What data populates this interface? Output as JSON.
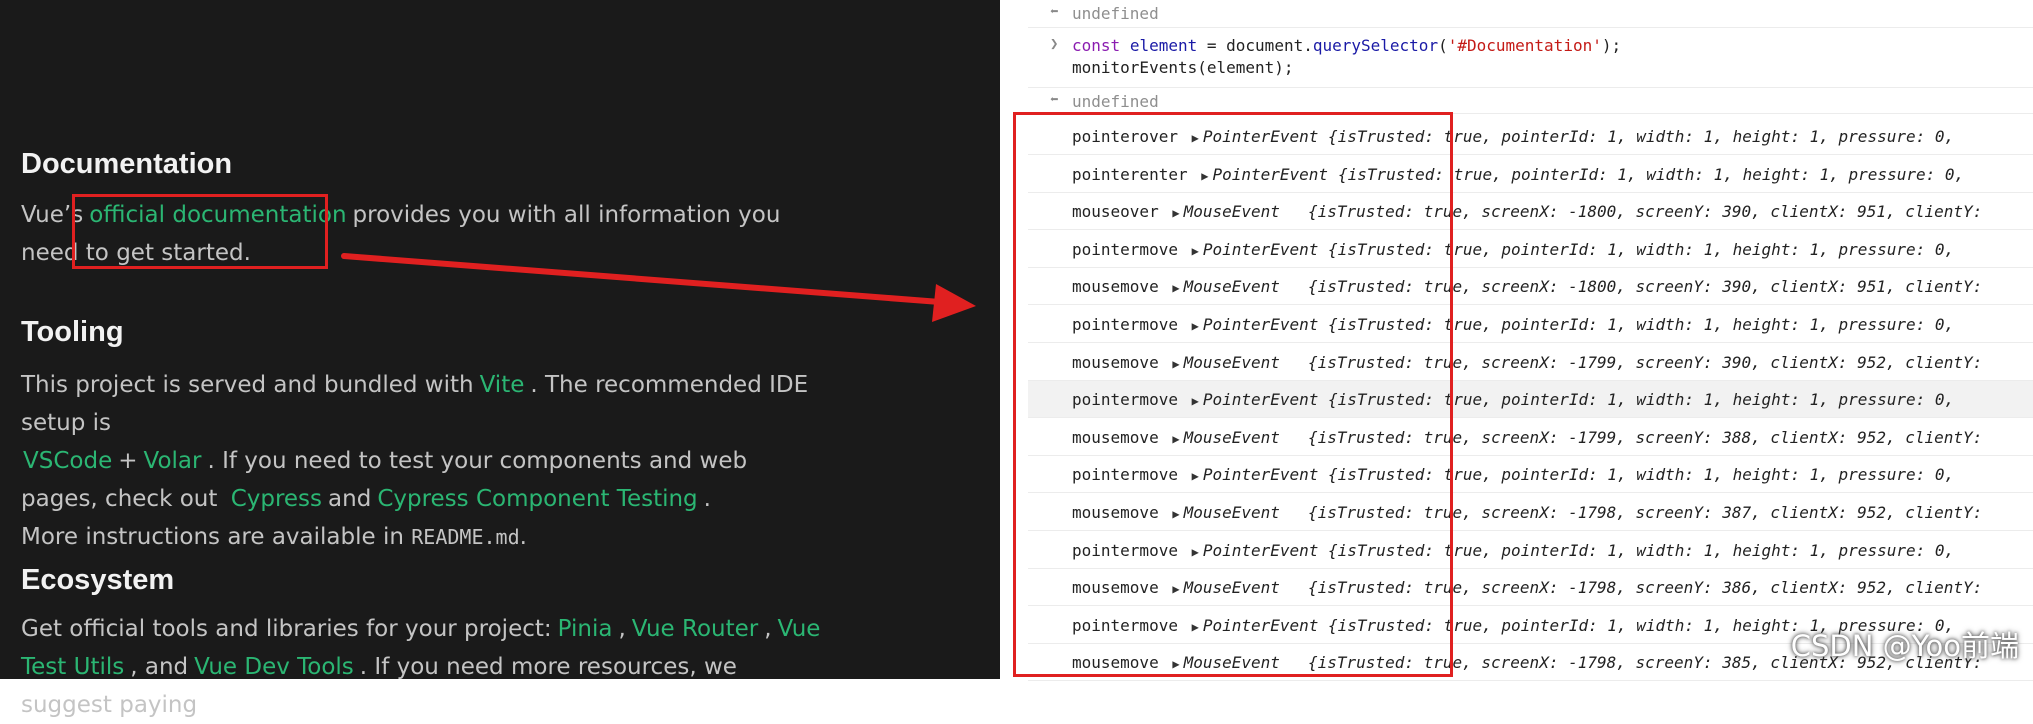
{
  "vue_page": {
    "documentation": {
      "title": "Documentation",
      "pre": "Vue’s",
      "link": "official documentation",
      "post": "provides you with all information you need to get started."
    },
    "tooling": {
      "title": "Tooling",
      "t1": "This project is served and bundled with",
      "vite": "Vite",
      "t2": ". The recommended IDE setup is",
      "vscode": "VSCode",
      "plus": "+",
      "volar": "Volar",
      "t3": ". If you need to test your components and web pages, check out",
      "cypress": "Cypress",
      "and": "and",
      "cct": "Cypress Component Testing",
      "dot": ".",
      "t4": "More instructions are available in",
      "readme": "README.md",
      "dot2": "."
    },
    "ecosystem": {
      "title": "Ecosystem",
      "t1": "Get official tools and libraries for your project:",
      "pinia": "Pinia",
      "comma1": ",",
      "router": "Vue Router",
      "comma2": ",",
      "vuetest": "Vue Test Utils",
      "t2": ", and",
      "devtools": "Vue Dev Tools",
      "t3": ". If you need more resources, we suggest paying"
    }
  },
  "console": {
    "undefined_1": "undefined",
    "cmd_line1_kw": "const",
    "cmd_line1_var": "element",
    "cmd_line1_mid": " = document.",
    "cmd_line1_fn": "querySelector",
    "cmd_line1_open": "(",
    "cmd_line1_str": "'#Documentation'",
    "cmd_line1_close": ");",
    "cmd_line2": "monitorEvents(element);",
    "undefined_2": "undefined",
    "events": [
      {
        "name": "pointerover",
        "type": "PointerEvent",
        "props": "{isTrusted: true, pointerId: 1, width: 1, height: 1, pressure: 0,"
      },
      {
        "name": "pointerenter",
        "type": "PointerEvent",
        "props": "{isTrusted: true, pointerId: 1, width: 1, height: 1, pressure: 0,"
      },
      {
        "name": "mouseover",
        "type": "MouseEvent",
        "props": "{isTrusted: true, screenX: -1800, screenY: 390, clientX: 951, clientY:"
      },
      {
        "name": "pointermove",
        "type": "PointerEvent",
        "props": "{isTrusted: true, pointerId: 1, width: 1, height: 1, pressure: 0,"
      },
      {
        "name": "mousemove",
        "type": "MouseEvent",
        "props": "{isTrusted: true, screenX: -1800, screenY: 390, clientX: 951, clientY:"
      },
      {
        "name": "pointermove",
        "type": "PointerEvent",
        "props": "{isTrusted: true, pointerId: 1, width: 1, height: 1, pressure: 0,"
      },
      {
        "name": "mousemove",
        "type": "MouseEvent",
        "props": "{isTrusted: true, screenX: -1799, screenY: 390, clientX: 952, clientY:"
      },
      {
        "name": "pointermove",
        "type": "PointerEvent",
        "props": "{isTrusted: true, pointerId: 1, width: 1, height: 1, pressure: 0,"
      },
      {
        "name": "mousemove",
        "type": "MouseEvent",
        "props": "{isTrusted: true, screenX: -1799, screenY: 388, clientX: 952, clientY:"
      },
      {
        "name": "pointermove",
        "type": "PointerEvent",
        "props": "{isTrusted: true, pointerId: 1, width: 1, height: 1, pressure: 0,"
      },
      {
        "name": "mousemove",
        "type": "MouseEvent",
        "props": "{isTrusted: true, screenX: -1798, screenY: 387, clientX: 952, clientY:"
      },
      {
        "name": "pointermove",
        "type": "PointerEvent",
        "props": "{isTrusted: true, pointerId: 1, width: 1, height: 1, pressure: 0,"
      },
      {
        "name": "mousemove",
        "type": "MouseEvent",
        "props": "{isTrusted: true, screenX: -1798, screenY: 386, clientX: 952, clientY:"
      },
      {
        "name": "pointermove",
        "type": "PointerEvent",
        "props": "{isTrusted: true, pointerId: 1, width: 1, height: 1, pressure: 0,"
      },
      {
        "name": "mousemove",
        "type": "MouseEvent",
        "props": "{isTrusted: true, screenX: -1798, screenY: 385, clientX: 952, clientY:"
      }
    ]
  },
  "watermark": "CSDN @Yoo前端",
  "colors": {
    "annotation": "#e02020",
    "link": "#2bb673",
    "page_bg": "#1a1a1a"
  }
}
